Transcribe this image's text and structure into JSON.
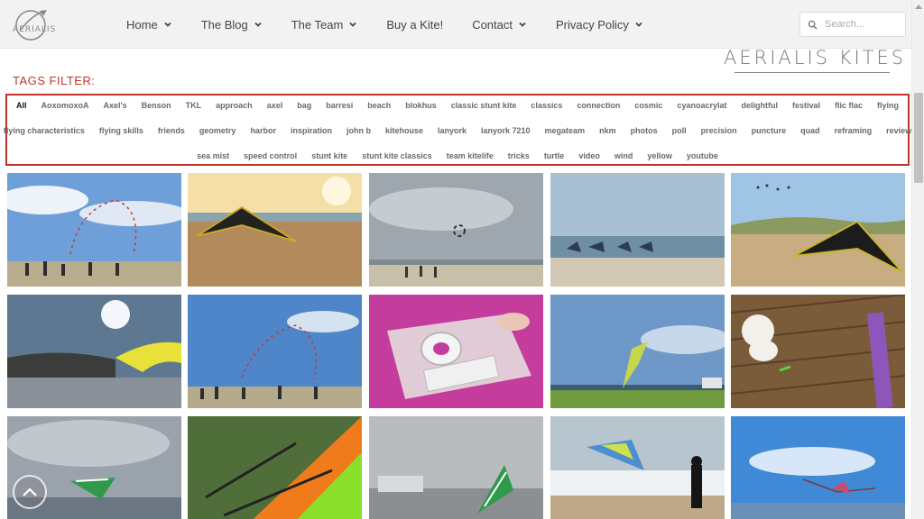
{
  "nav": {
    "logo_text": "AERIALIS",
    "items": [
      {
        "label": "Home",
        "dropdown": true
      },
      {
        "label": "The Blog",
        "dropdown": true
      },
      {
        "label": "The Team",
        "dropdown": true
      },
      {
        "label": "Buy a Kite!",
        "dropdown": false
      },
      {
        "label": "Contact",
        "dropdown": true
      },
      {
        "label": "Privacy Policy",
        "dropdown": true
      }
    ],
    "search_placeholder": "Search..."
  },
  "site_title": "AERIALIS KITES",
  "tags_title": "TAGS FILTER:",
  "tags": {
    "row1": [
      "All",
      "AoxomoxoA",
      "Axel's",
      "Benson",
      "TKL",
      "approach",
      "axel",
      "bag",
      "barresi",
      "beach",
      "blokhus",
      "classic stunt kite",
      "classics",
      "connection",
      "cosmic",
      "cyanoacrylat",
      "delightful",
      "festival",
      "flic flac",
      "flying"
    ],
    "row2": [
      "flying characteristics",
      "flying skills",
      "friends",
      "geometry",
      "harbor",
      "inspiration",
      "john b",
      "kitehouse",
      "lanyork",
      "lanyork 7210",
      "megateam",
      "nkm",
      "photos",
      "poll",
      "precision",
      "puncture",
      "quad",
      "reframing",
      "review"
    ],
    "row3": [
      "sea mist",
      "speed control",
      "stunt kite",
      "stunt kite classics",
      "team kitelife",
      "tricks",
      "turtle",
      "video",
      "wind",
      "yellow",
      "youtube"
    ],
    "active": "All"
  },
  "colors": {
    "accent_red": "#c0342c",
    "nav_bg": "#f2f2f2"
  },
  "gallery": {
    "count": 15
  }
}
